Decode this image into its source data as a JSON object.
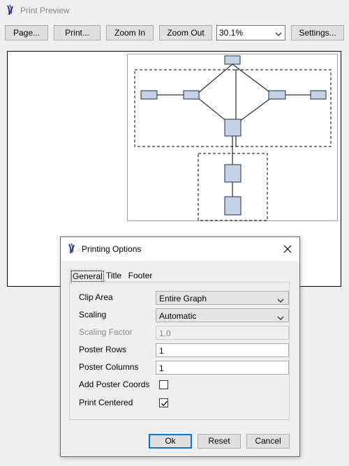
{
  "window": {
    "title": "Print Preview"
  },
  "toolbar": {
    "page_label": "Page...",
    "print_label": "Print...",
    "zoom_in_label": "Zoom In",
    "zoom_out_label": "Zoom Out",
    "zoom_value": "30.1%",
    "settings_label": "Settings..."
  },
  "dialog": {
    "title": "Printing Options",
    "tabs": [
      {
        "label": "General",
        "active": true
      },
      {
        "label": "Title",
        "active": false
      },
      {
        "label": "Footer",
        "active": false
      }
    ],
    "fields": {
      "clip_area_label": "Clip Area",
      "clip_area_value": "Entire Graph",
      "scaling_label": "Scaling",
      "scaling_value": "Automatic",
      "scaling_factor_label": "Scaling Factor",
      "scaling_factor_value": "1.0",
      "poster_rows_label": "Poster Rows",
      "poster_rows_value": "1",
      "poster_columns_label": "Poster Columns",
      "poster_columns_value": "1",
      "add_poster_coords_label": "Add Poster Coords",
      "add_poster_coords_checked": false,
      "print_centered_label": "Print Centered",
      "print_centered_checked": true
    },
    "buttons": {
      "ok": "Ok",
      "reset": "Reset",
      "cancel": "Cancel"
    }
  },
  "colors": {
    "node_fill": "#c5d3e6",
    "node_border": "#1f2f4a",
    "default_button_border": "#0078d7",
    "window_bg": "#f0f0f0"
  },
  "icons": {
    "app": "app-logo-icon",
    "chevron": "chevron-down-icon",
    "close": "close-icon",
    "check": "check-icon"
  }
}
